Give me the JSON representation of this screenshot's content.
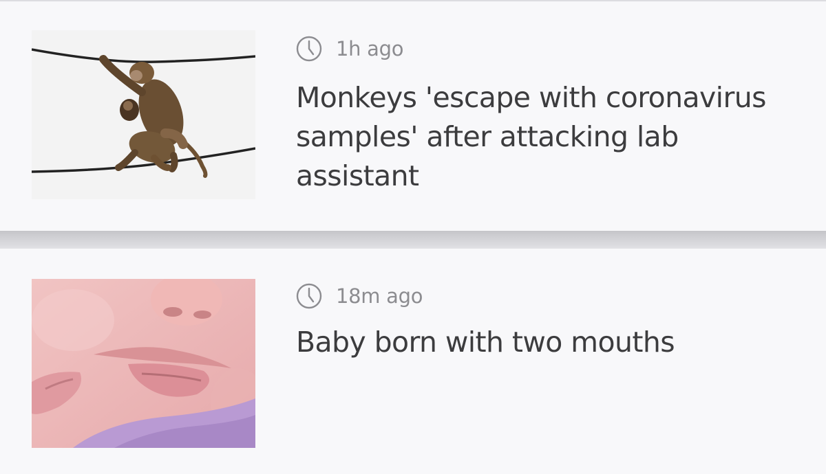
{
  "feed": {
    "items": [
      {
        "time": "1h ago",
        "headline": "Monkeys 'escape with coronavirus samples' after attacking lab assistant",
        "image_icon": "monkey-photo"
      },
      {
        "time": "18m ago",
        "headline": "Baby born with two mouths",
        "image_icon": "baby-face-photo"
      }
    ]
  },
  "colors": {
    "background": "#f8f8fa",
    "headline_text": "#3c3c3e",
    "time_text": "#8c8c90",
    "divider": "#d0d0d4"
  }
}
